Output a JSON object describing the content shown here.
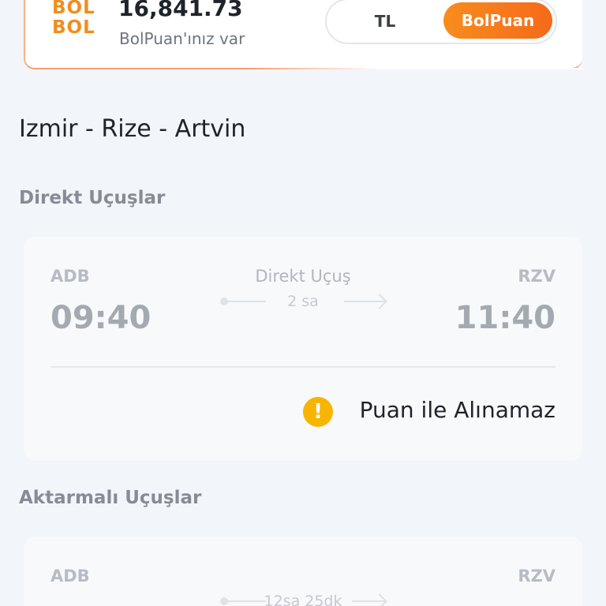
{
  "points": {
    "logo_line1": "BOL",
    "logo_line2": "BOL",
    "value": "16,841.73",
    "caption": "BolPuan'ınız var",
    "toggle_tl": "TL",
    "toggle_bolpuan": "BolPuan"
  },
  "route_title": "Izmir - Rize - Artvin",
  "sections": {
    "direct_title": "Direkt Uçuşlar",
    "connecting_title": "Aktarmalı Uçuşlar"
  },
  "direct_flight": {
    "from_code": "ADB",
    "to_code": "RZV",
    "depart_time": "09:40",
    "arrive_time": "11:40",
    "type_label": "Direkt Uçuş",
    "duration": "2 sa",
    "warning_icon": "exclamation-icon",
    "warning_text": "Puan ile Alınamaz"
  },
  "connecting_flight": {
    "from_code": "ADB",
    "to_code": "RZV",
    "duration": "12sa 25dk"
  },
  "colors": {
    "accent": "#f56a1a",
    "warning": "#f7b500",
    "background": "#f2f5f9"
  }
}
